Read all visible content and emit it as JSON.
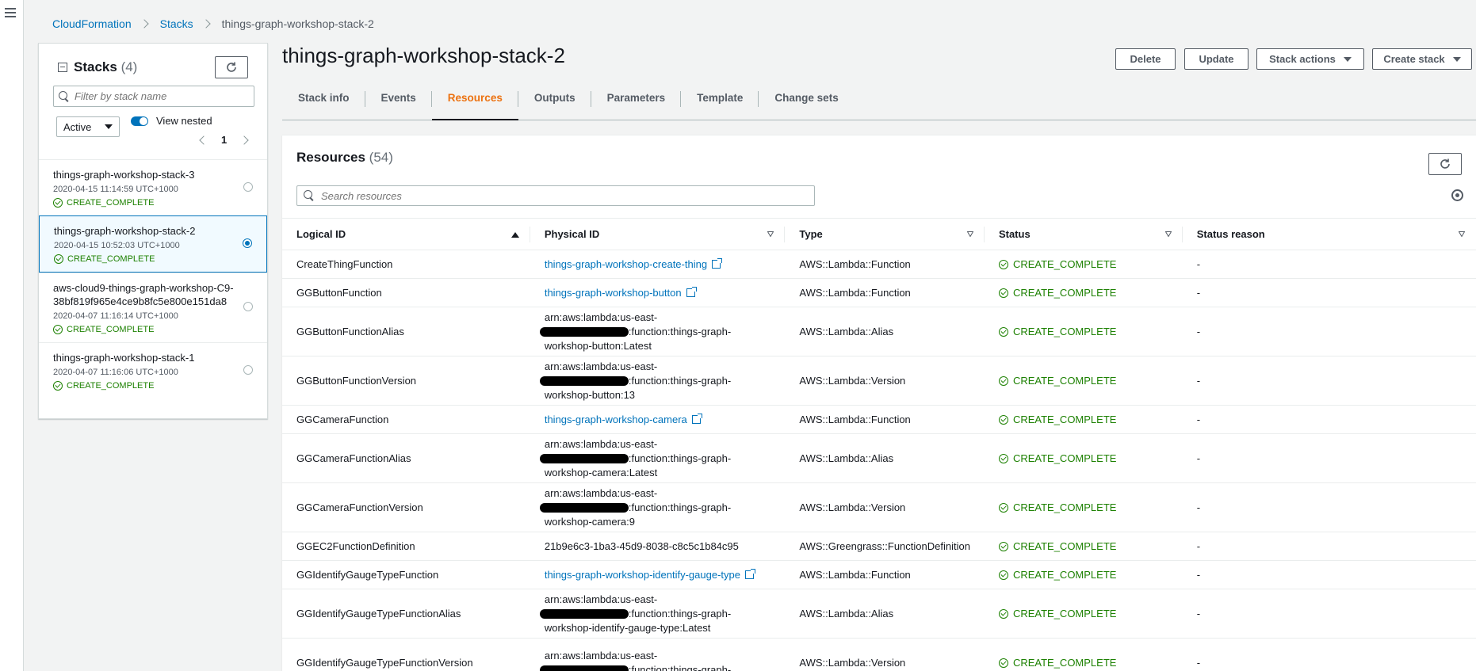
{
  "breadcrumb": [
    "CloudFormation",
    "Stacks",
    "things-graph-workshop-stack-2"
  ],
  "stacks_panel": {
    "title": "Stacks",
    "count": "(4)",
    "filter_placeholder": "Filter by stack name",
    "status_filter": "Active",
    "view_nested_label": "View nested",
    "page": "1",
    "stacks": [
      {
        "name": "things-graph-workshop-stack-3",
        "time": "2020-04-15 11:14:59 UTC+1000",
        "status": "CREATE_COMPLETE"
      },
      {
        "name": "things-graph-workshop-stack-2",
        "time": "2020-04-15 10:52:03 UTC+1000",
        "status": "CREATE_COMPLETE"
      },
      {
        "name": "aws-cloud9-things-graph-workshop-C9-38bf819f965e4ce9b8fc5e800e151da8",
        "time": "2020-04-07 11:16:14 UTC+1000",
        "status": "CREATE_COMPLETE"
      },
      {
        "name": "things-graph-workshop-stack-1",
        "time": "2020-04-07 11:16:06 UTC+1000",
        "status": "CREATE_COMPLETE"
      }
    ]
  },
  "stack_title": "things-graph-workshop-stack-2",
  "actions": {
    "delete": "Delete",
    "update": "Update",
    "stack_actions": "Stack actions",
    "create_stack": "Create stack"
  },
  "tabs": [
    "Stack info",
    "Events",
    "Resources",
    "Outputs",
    "Parameters",
    "Template",
    "Change sets"
  ],
  "resources": {
    "title": "Resources",
    "count": "(54)",
    "search_placeholder": "Search resources",
    "columns": [
      "Logical ID",
      "Physical ID",
      "Type",
      "Status",
      "Status reason"
    ],
    "rows": [
      {
        "logical": "CreateThingFunction",
        "physical": "things-graph-workshop-create-thing",
        "type": "AWS::Lambda::Function",
        "status": "CREATE_COMPLETE",
        "reason": "-"
      },
      {
        "logical": "GGButtonFunction",
        "physical": "things-graph-workshop-button",
        "type": "AWS::Lambda::Function",
        "status": "CREATE_COMPLETE",
        "reason": "-"
      },
      {
        "logical": "GGButtonFunctionAlias",
        "arn1": "arn:aws:lambda:us-east-",
        "arn2": ":function:things-graph-",
        "arn3": "workshop-button:Latest",
        "type": "AWS::Lambda::Alias",
        "status": "CREATE_COMPLETE",
        "reason": "-"
      },
      {
        "logical": "GGButtonFunctionVersion",
        "arn1": "arn:aws:lambda:us-east-",
        "arn2": ":function:things-graph-",
        "arn3": "workshop-button:13",
        "type": "AWS::Lambda::Version",
        "status": "CREATE_COMPLETE",
        "reason": "-"
      },
      {
        "logical": "GGCameraFunction",
        "physical": "things-graph-workshop-camera",
        "type": "AWS::Lambda::Function",
        "status": "CREATE_COMPLETE",
        "reason": "-"
      },
      {
        "logical": "GGCameraFunctionAlias",
        "arn1": "arn:aws:lambda:us-east-",
        "arn2": ":function:things-graph-",
        "arn3": "workshop-camera:Latest",
        "type": "AWS::Lambda::Alias",
        "status": "CREATE_COMPLETE",
        "reason": "-"
      },
      {
        "logical": "GGCameraFunctionVersion",
        "arn1": "arn:aws:lambda:us-east-",
        "arn2": ":function:things-graph-",
        "arn3": "workshop-camera:9",
        "type": "AWS::Lambda::Version",
        "status": "CREATE_COMPLETE",
        "reason": "-"
      },
      {
        "logical": "GGEC2FunctionDefinition",
        "plain": "21b9e6c3-1ba3-45d9-8038-c8c5c1b84c95",
        "type": "AWS::Greengrass::FunctionDefinition",
        "status": "CREATE_COMPLETE",
        "reason": "-"
      },
      {
        "logical": "GGIdentifyGaugeTypeFunction",
        "physical": "things-graph-workshop-identify-gauge-type",
        "type": "AWS::Lambda::Function",
        "status": "CREATE_COMPLETE",
        "reason": "-"
      },
      {
        "logical": "GGIdentifyGaugeTypeFunctionAlias",
        "arn1": "arn:aws:lambda:us-east-",
        "arn2": ":function:things-graph-",
        "arn3": "workshop-identify-gauge-type:Latest",
        "type": "AWS::Lambda::Alias",
        "status": "CREATE_COMPLETE",
        "reason": "-"
      },
      {
        "logical": "GGIdentifyGaugeTypeFunctionVersion",
        "arn1": "arn:aws:lambda:us-east-",
        "arn2": ":function:things-graph-",
        "arn3": "",
        "type": "AWS::Lambda::Version",
        "status": "CREATE_COMPLETE",
        "reason": "-"
      }
    ]
  }
}
